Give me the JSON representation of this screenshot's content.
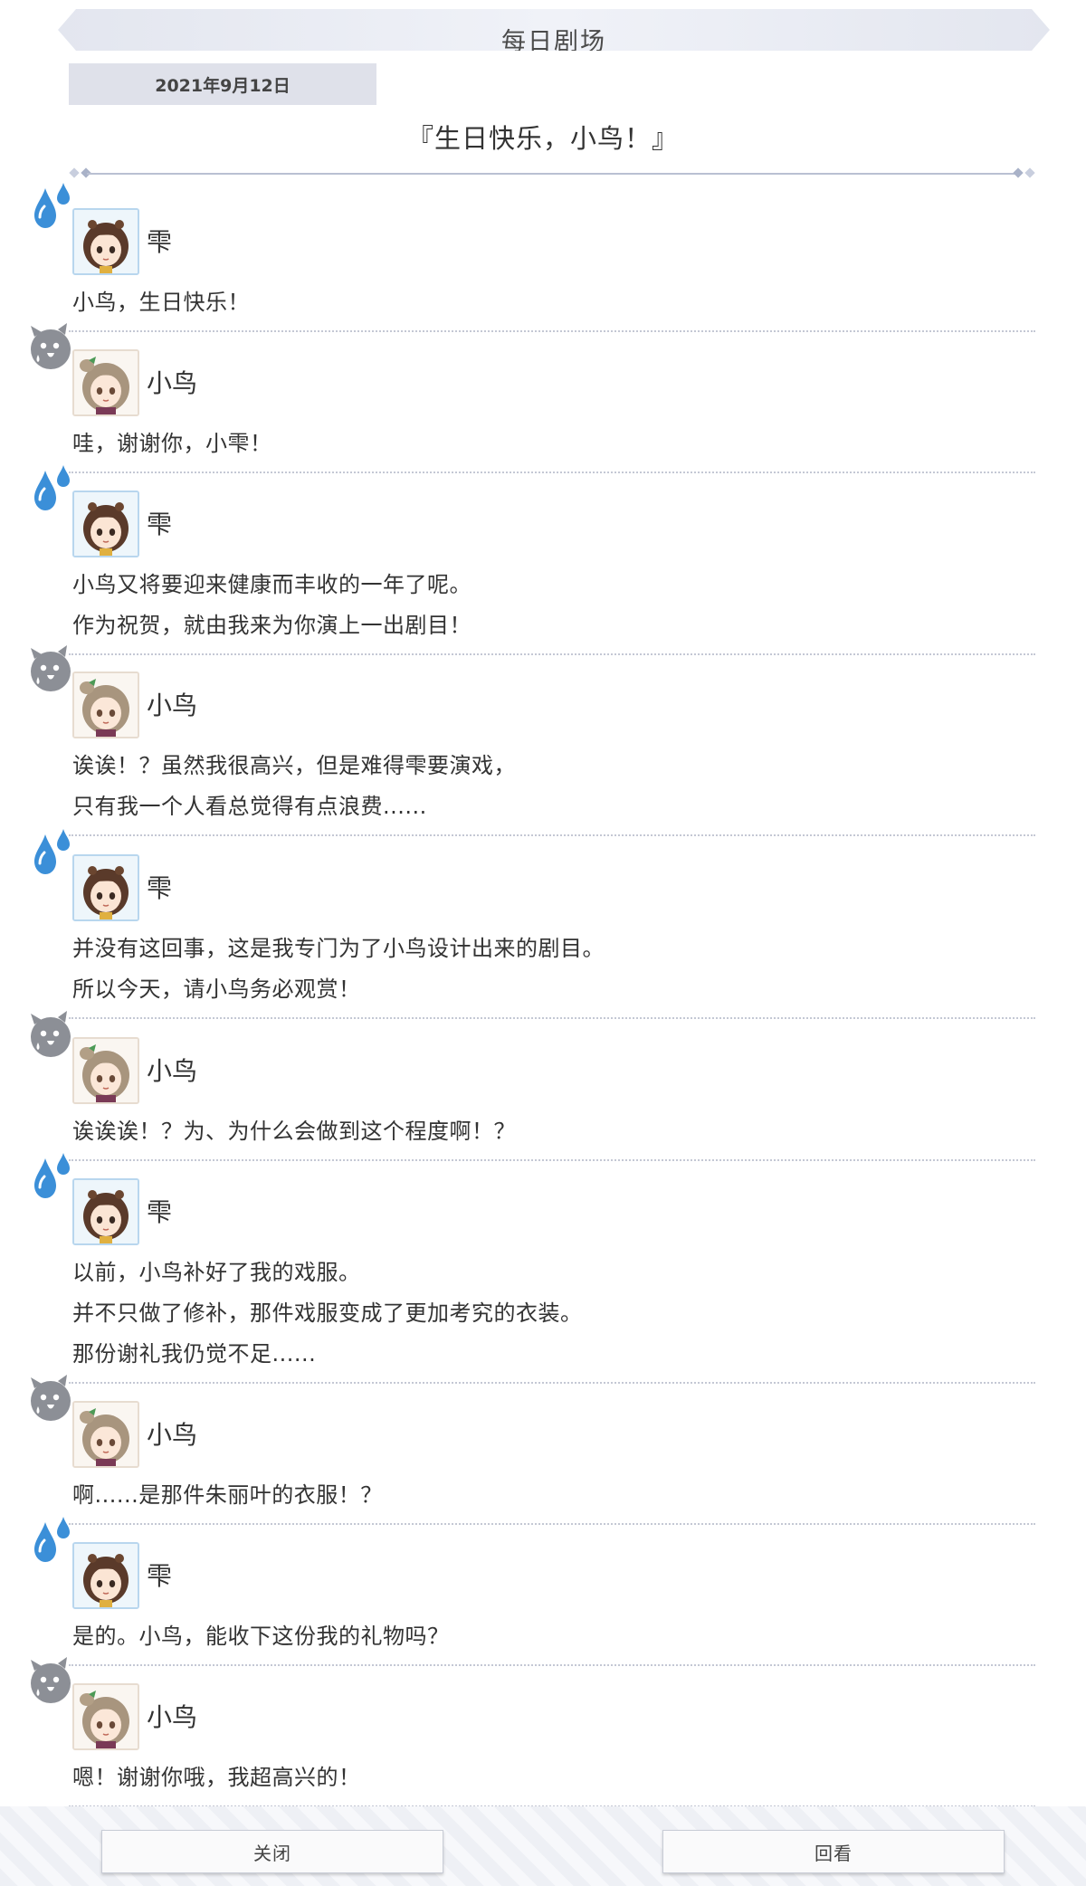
{
  "header": {
    "title": "每日剧场",
    "date": "2021年9月12日",
    "story_title": "『生日快乐，小鸟！』"
  },
  "colors": {
    "shizuku_border": "#b8d6ee",
    "kotori_border": "#e7dcd0",
    "divider": "#b9c0d2"
  },
  "dialogue": [
    {
      "speaker": "雫",
      "character": "shizuku",
      "emote": "water-drops-icon",
      "lines": [
        "小鸟，生日快乐！"
      ]
    },
    {
      "speaker": "小鸟",
      "character": "kotori",
      "emote": "sweat-face-icon",
      "lines": [
        "哇，谢谢你，小雫！"
      ]
    },
    {
      "speaker": "雫",
      "character": "shizuku",
      "emote": "water-drops-icon",
      "lines": [
        "小鸟又将要迎来健康而丰收的一年了呢。",
        "作为祝贺，就由我来为你演上一出剧目！"
      ]
    },
    {
      "speaker": "小鸟",
      "character": "kotori",
      "emote": "sweat-face-icon",
      "lines": [
        "诶诶！？虽然我很高兴，但是难得雫要演戏，",
        "只有我一个人看总觉得有点浪费......"
      ]
    },
    {
      "speaker": "雫",
      "character": "shizuku",
      "emote": "water-drops-icon",
      "lines": [
        "并没有这回事，这是我专门为了小鸟设计出来的剧目。",
        "所以今天，请小鸟务必观赏！"
      ]
    },
    {
      "speaker": "小鸟",
      "character": "kotori",
      "emote": "sweat-face-icon",
      "lines": [
        "诶诶诶！？为、为什么会做到这个程度啊！？"
      ]
    },
    {
      "speaker": "雫",
      "character": "shizuku",
      "emote": "water-drops-icon",
      "lines": [
        "以前，小鸟补好了我的戏服。",
        "并不只做了修补，那件戏服变成了更加考究的衣装。",
        "那份谢礼我仍觉不足......"
      ]
    },
    {
      "speaker": "小鸟",
      "character": "kotori",
      "emote": "sweat-face-icon",
      "lines": [
        "啊......是那件朱丽叶的衣服！？"
      ]
    },
    {
      "speaker": "雫",
      "character": "shizuku",
      "emote": "water-drops-icon",
      "lines": [
        "是的。小鸟，能收下这份我的礼物吗？"
      ]
    },
    {
      "speaker": "小鸟",
      "character": "kotori",
      "emote": "sweat-face-icon",
      "lines": [
        "嗯！谢谢你哦，我超高兴的！"
      ]
    }
  ],
  "footer": {
    "close_label": "关闭",
    "replay_label": "回看"
  }
}
